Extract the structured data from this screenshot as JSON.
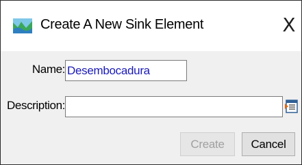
{
  "window": {
    "title": "Create A New Sink Element",
    "icon": "sink-element-icon",
    "close_glyph": "X"
  },
  "form": {
    "name_label": "Name:",
    "name_value": "Desembocadura",
    "description_label": "Description:",
    "description_value": "",
    "description_picker_icon": "text-editor-icon"
  },
  "buttons": {
    "create_label": "Create",
    "create_enabled": false,
    "cancel_label": "Cancel"
  },
  "colors": {
    "input_text": "#1a1ab8",
    "disabled_text": "#a0a0a0"
  }
}
